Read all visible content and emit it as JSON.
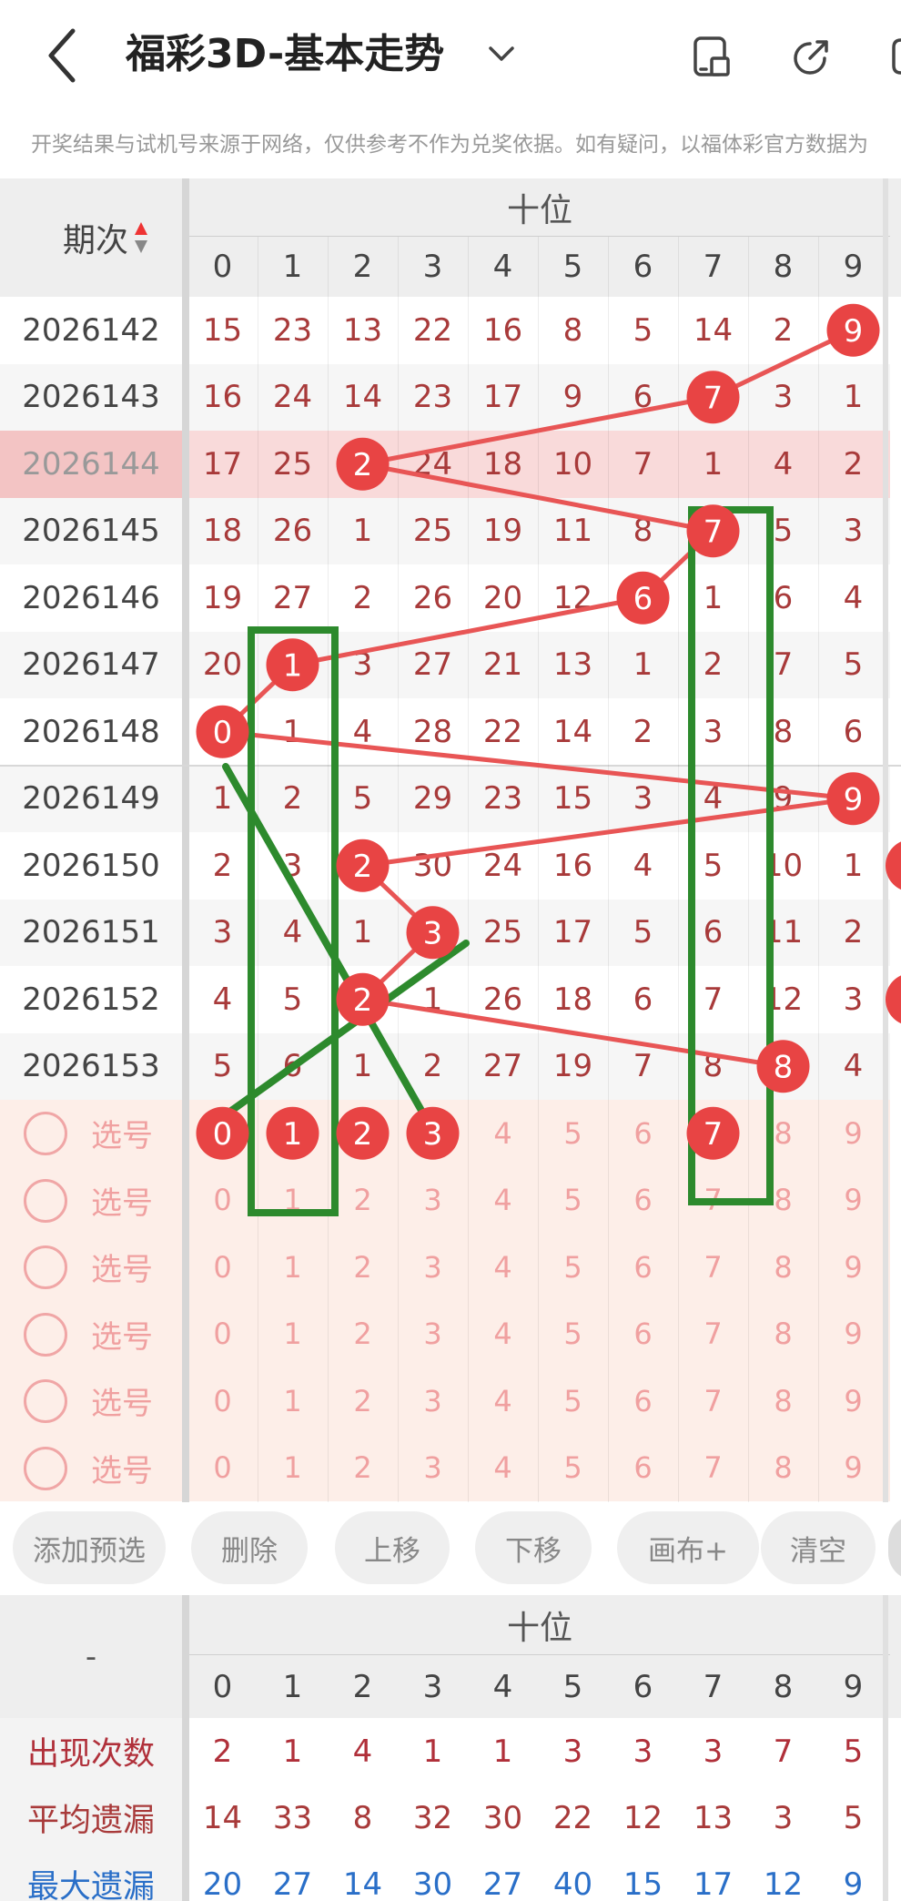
{
  "header": {
    "title": "福彩3D-基本走势",
    "back_icon": "chevron-left-icon",
    "title_dropdown_icon": "chevron-down-icon",
    "icons": [
      "device-layout-icon",
      "share-icon",
      "more-icon"
    ]
  },
  "notice": "开奖结果与试机号来源于网络，仅供参考不作为兑奖依据。如有疑问，以福体彩官方数据为",
  "table": {
    "period_header": "期次",
    "sort_icon": "sort-arrows-icon",
    "position_header": "十位",
    "digits": [
      "0",
      "1",
      "2",
      "3",
      "4",
      "5",
      "6",
      "7",
      "8",
      "9"
    ],
    "rows": [
      {
        "period": "2026142",
        "cells": [
          "15",
          "23",
          "13",
          "22",
          "16",
          "8",
          "5",
          "14",
          "2",
          "9"
        ],
        "hit": 9
      },
      {
        "period": "2026143",
        "cells": [
          "16",
          "24",
          "14",
          "23",
          "17",
          "9",
          "6",
          "7",
          "3",
          "1"
        ],
        "hit": 7
      },
      {
        "period": "2026144",
        "cells": [
          "17",
          "25",
          "2",
          "24",
          "18",
          "10",
          "7",
          "1",
          "4",
          "2"
        ],
        "hit": 2
      },
      {
        "period": "2026145",
        "cells": [
          "18",
          "26",
          "1",
          "25",
          "19",
          "11",
          "8",
          "7",
          "5",
          "3"
        ],
        "hit": 7
      },
      {
        "period": "2026146",
        "cells": [
          "19",
          "27",
          "2",
          "26",
          "20",
          "12",
          "6",
          "1",
          "6",
          "4"
        ],
        "hit": 6
      },
      {
        "period": "2026147",
        "cells": [
          "20",
          "1",
          "3",
          "27",
          "21",
          "13",
          "1",
          "2",
          "7",
          "5"
        ],
        "hit": 1
      },
      {
        "period": "2026148",
        "cells": [
          "0",
          "1",
          "4",
          "28",
          "22",
          "14",
          "2",
          "3",
          "8",
          "6"
        ],
        "hit": 0
      },
      {
        "period": "2026149",
        "cells": [
          "1",
          "2",
          "5",
          "29",
          "23",
          "15",
          "3",
          "4",
          "9",
          "9"
        ],
        "hit": 9
      },
      {
        "period": "2026150",
        "cells": [
          "2",
          "3",
          "2",
          "30",
          "24",
          "16",
          "4",
          "5",
          "10",
          "1"
        ],
        "hit": 2
      },
      {
        "period": "2026151",
        "cells": [
          "3",
          "4",
          "1",
          "3",
          "25",
          "17",
          "5",
          "6",
          "11",
          "2"
        ],
        "hit": 3
      },
      {
        "period": "2026152",
        "cells": [
          "4",
          "5",
          "2",
          "1",
          "26",
          "18",
          "6",
          "7",
          "12",
          "3"
        ],
        "hit": 2
      },
      {
        "period": "2026153",
        "cells": [
          "5",
          "6",
          "1",
          "2",
          "27",
          "19",
          "7",
          "8",
          "8",
          "4"
        ],
        "hit": 8
      }
    ],
    "pick_label": "选号",
    "pick_rows": [
      {
        "selected": [
          0,
          1,
          2,
          3,
          7
        ]
      },
      {
        "selected": []
      },
      {
        "selected": []
      },
      {
        "selected": []
      },
      {
        "selected": []
      },
      {
        "selected": []
      }
    ]
  },
  "buttons": [
    "添加预选",
    "删除",
    "上移",
    "下移",
    "画布+",
    "清空"
  ],
  "stats": {
    "corner": "-",
    "position_header": "十位",
    "rows": [
      {
        "label": "出现次数",
        "values": [
          "2",
          "1",
          "4",
          "1",
          "1",
          "3",
          "3",
          "3",
          "7",
          "5"
        ]
      },
      {
        "label": "平均遗漏",
        "values": [
          "14",
          "33",
          "8",
          "32",
          "30",
          "22",
          "12",
          "13",
          "3",
          "5"
        ]
      },
      {
        "label": "最大遗漏",
        "values": [
          "20",
          "27",
          "14",
          "30",
          "27",
          "40",
          "15",
          "17",
          "12",
          "9"
        ]
      }
    ]
  },
  "colors": {
    "ball": "#e84444",
    "trend_line": "#e85555",
    "cell_text": "#a83a3a",
    "pick_text": "#f0a0a0",
    "annotation_green": "#2d8a2d",
    "max_miss_text": "#2a6fc8",
    "highlight_row": "#f9dada",
    "pick_bg": "#fdeee8"
  }
}
